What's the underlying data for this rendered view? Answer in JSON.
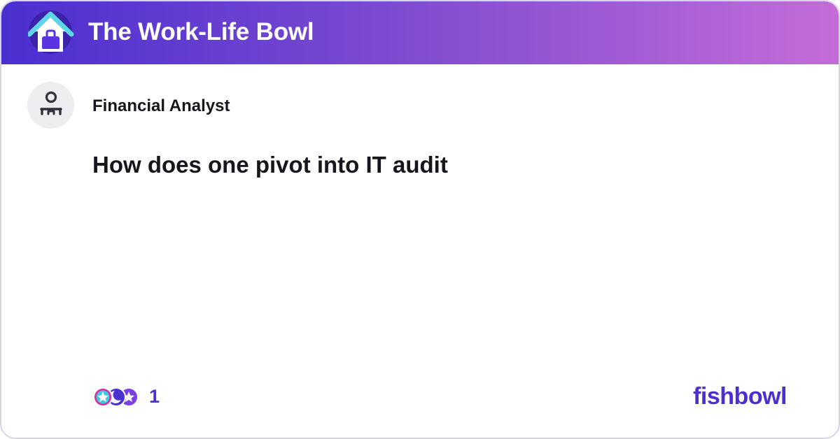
{
  "header": {
    "bowl_name": "The Work-Life Bowl",
    "bowl_icon": "house-briefcase-icon"
  },
  "post": {
    "author": "Financial Analyst",
    "author_icon": "user-icon",
    "title": "How does one pivot into IT audit"
  },
  "footer": {
    "reaction_icons": [
      "star-reaction-icon",
      "moon-reaction-icon",
      "star-reaction-icon"
    ],
    "reaction_count": "1",
    "brand": "fishbowl"
  },
  "colors": {
    "header_gradient_start": "#4b2fd0",
    "header_gradient_end": "#c46cd8",
    "accent": "#4b2fd0",
    "text": "#16171d",
    "avatar_bg": "#eeeef1"
  }
}
